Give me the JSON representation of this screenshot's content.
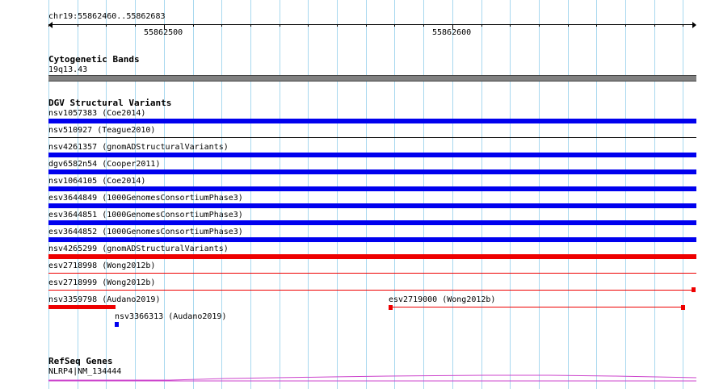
{
  "ruler": {
    "coordinates": "chr19:55862460..55862683",
    "tick_labels": [
      "55862500",
      "55862600"
    ]
  },
  "cytoband_track": {
    "title": "Cytogenetic Bands",
    "band_label": "19q13.43",
    "band_color": "#808080"
  },
  "dgv_track": {
    "title": "DGV Structural Variants",
    "colors": {
      "loss": "#0000ee",
      "gain": "#ee0000"
    },
    "features": [
      {
        "id": "nsv1057383",
        "label": "nsv1057383 (Coe2014)",
        "type": "loss"
      },
      {
        "id": "nsv510927",
        "label": "nsv510927 (Teague2010)",
        "type": "line"
      },
      {
        "id": "nsv4261357",
        "label": "nsv4261357 (gnomADStructuralVariants)",
        "type": "loss"
      },
      {
        "id": "dgv6582n54",
        "label": "dgv6582n54 (Cooper2011)",
        "type": "loss"
      },
      {
        "id": "nsv1064105",
        "label": "nsv1064105 (Coe2014)",
        "type": "loss"
      },
      {
        "id": "esv3644849",
        "label": "esv3644849 (1000GenomesConsortiumPhase3)",
        "type": "loss"
      },
      {
        "id": "esv3644851",
        "label": "esv3644851 (1000GenomesConsortiumPhase3)",
        "type": "loss"
      },
      {
        "id": "esv3644852",
        "label": "esv3644852 (1000GenomesConsortiumPhase3)",
        "type": "loss"
      },
      {
        "id": "nsv4265299",
        "label": "nsv4265299 (gnomADStructuralVariants)",
        "type": "gain"
      },
      {
        "id": "esv2718998",
        "label": "esv2718998 (Wong2012b)",
        "type": "gain-line"
      },
      {
        "id": "esv2718999",
        "label": "esv2718999 (Wong2012b)",
        "type": "gain-line-end"
      },
      {
        "id": "nsv3359798",
        "label": "nsv3359798 (Audano2019)",
        "type": "gain-short"
      },
      {
        "id": "esv2719000",
        "label": "esv2719000 (Wong2012b)",
        "type": "gain-span"
      },
      {
        "id": "nsv3366313",
        "label": "nsv3366313 (Audano2019)",
        "type": "loss-dot"
      }
    ]
  },
  "refseq_track": {
    "title": "RefSeq Genes",
    "gene_label": "NLRP4|NM_134444",
    "gene_color": "#cc44cc"
  }
}
